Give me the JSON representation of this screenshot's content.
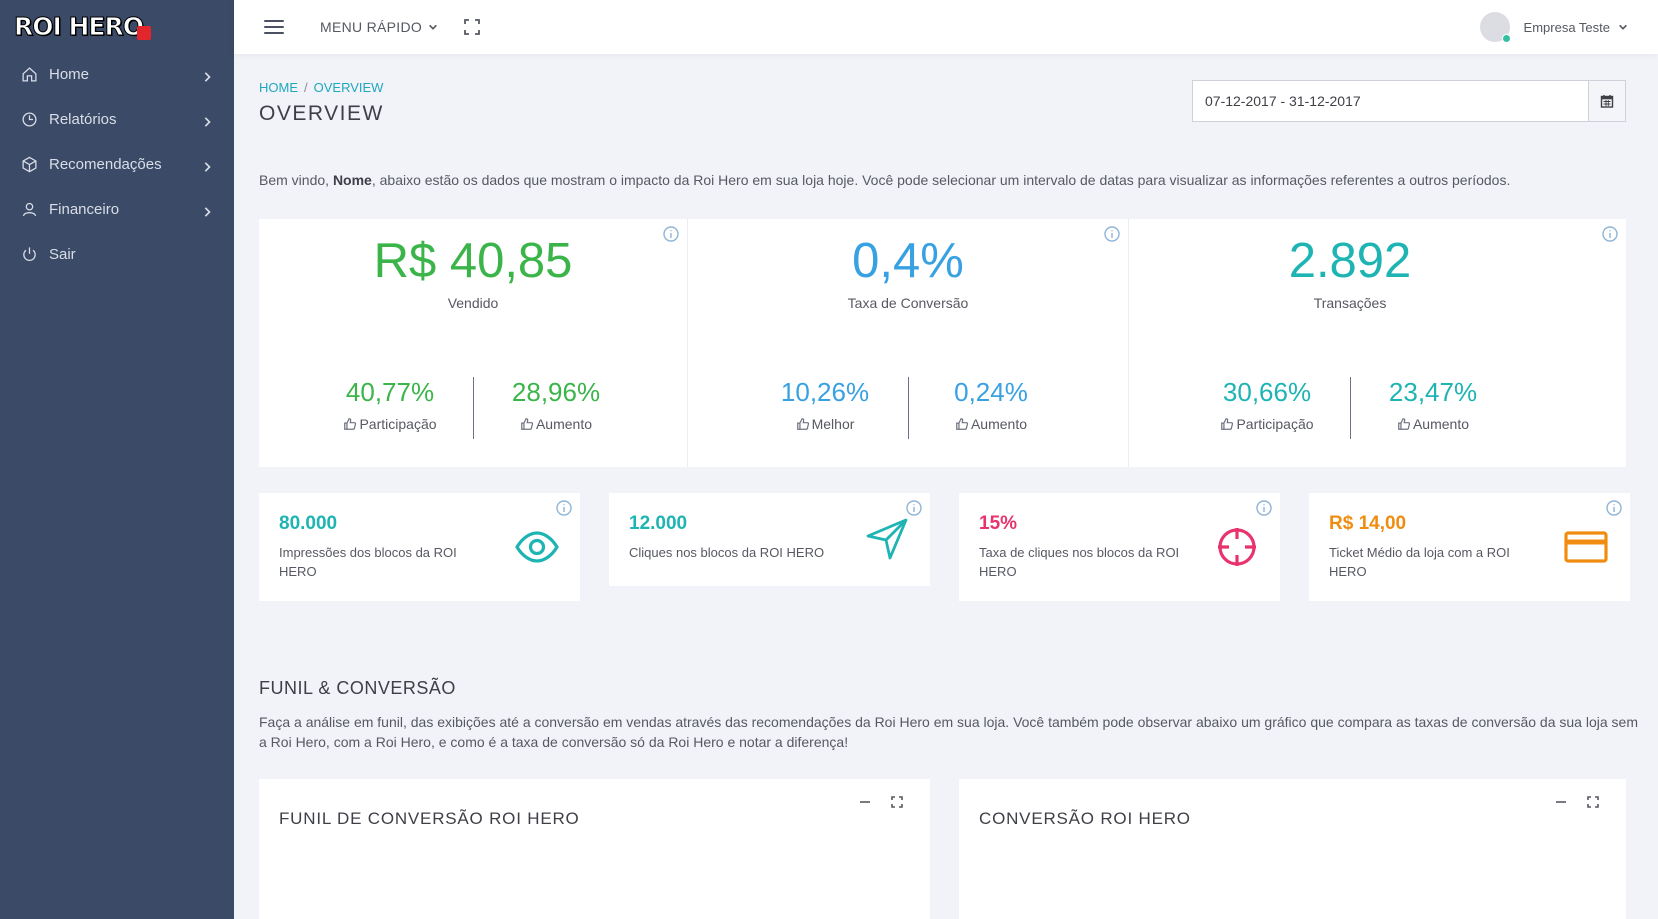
{
  "brand": {
    "logo_text": "ROI HERO"
  },
  "sidebar": {
    "items": [
      {
        "label": "Home",
        "icon": "home-icon",
        "has_submenu": true
      },
      {
        "label": "Relatórios",
        "icon": "clock-icon",
        "has_submenu": true
      },
      {
        "label": "Recomendações",
        "icon": "box-icon",
        "has_submenu": true
      },
      {
        "label": "Financeiro",
        "icon": "user-icon",
        "has_submenu": true
      },
      {
        "label": "Sair",
        "icon": "power-icon",
        "has_submenu": false
      }
    ]
  },
  "header": {
    "quick_menu_label": "MENU RÁPIDO",
    "user_name": "Empresa Teste"
  },
  "breadcrumb": {
    "home": "HOME",
    "separator": "/",
    "current": "OVERVIEW"
  },
  "page_title": "OVERVIEW",
  "date_range": {
    "value": "07-12-2017 - 31-12-2017"
  },
  "intro": {
    "prefix": "Bem vindo, ",
    "name": "Nome",
    "suffix": ", abaixo estão os dados que mostram o impacto da Roi Hero em sua loja hoje. Você pode selecionar um intervalo de datas para visualizar as informações referentes a outros períodos."
  },
  "big_stats": [
    {
      "value": "R$ 40,85",
      "label": "Vendido",
      "color": "#3bb54a",
      "subs": [
        {
          "value": "40,77%",
          "label": "Participação"
        },
        {
          "value": "28,96%",
          "label": "Aumento"
        }
      ]
    },
    {
      "value": "0,4%",
      "label": "Taxa de Conversão",
      "color": "#37a1e2",
      "subs": [
        {
          "value": "10,26%",
          "label": "Melhor"
        },
        {
          "value": "0,24%",
          "label": "Aumento"
        }
      ]
    },
    {
      "value": "2.892",
      "label": "Transações",
      "color": "#1eb4b3",
      "subs": [
        {
          "value": "30,66%",
          "label": "Participação"
        },
        {
          "value": "23,47%",
          "label": "Aumento"
        }
      ]
    }
  ],
  "small_cards": [
    {
      "value": "80.000",
      "label": "Impressões dos blocos da ROI HERO",
      "color": "#1eb4b3",
      "icon": "eye-icon"
    },
    {
      "value": "12.000",
      "label": "Cliques nos blocos da ROI HERO",
      "color": "#1eb4b3",
      "icon": "send-icon"
    },
    {
      "value": "15%",
      "label": "Taxa de cliques nos blocos da ROI HERO",
      "color": "#e8336d",
      "icon": "crosshair-icon"
    },
    {
      "value": "R$ 14,00",
      "label": "Ticket Médio da loja com a ROI HERO",
      "color": "#f08d10",
      "icon": "credit-card-icon"
    }
  ],
  "funnel_section": {
    "title": "FUNIL & CONVERSÃO",
    "description": "Faça a análise em funil, das exibições até a conversão em vendas através das recomendações da Roi Hero em sua loja. Você também pode observar abaixo um gráfico que compara as taxas de conversão da sua loja sem a Roi Hero, com a Roi Hero, e como é a taxa de conversão só da Roi Hero e notar a diferença!"
  },
  "panels": [
    {
      "title": "FUNIL DE CONVERSÃO ROI HERO"
    },
    {
      "title": "CONVERSÃO ROI HERO"
    }
  ]
}
